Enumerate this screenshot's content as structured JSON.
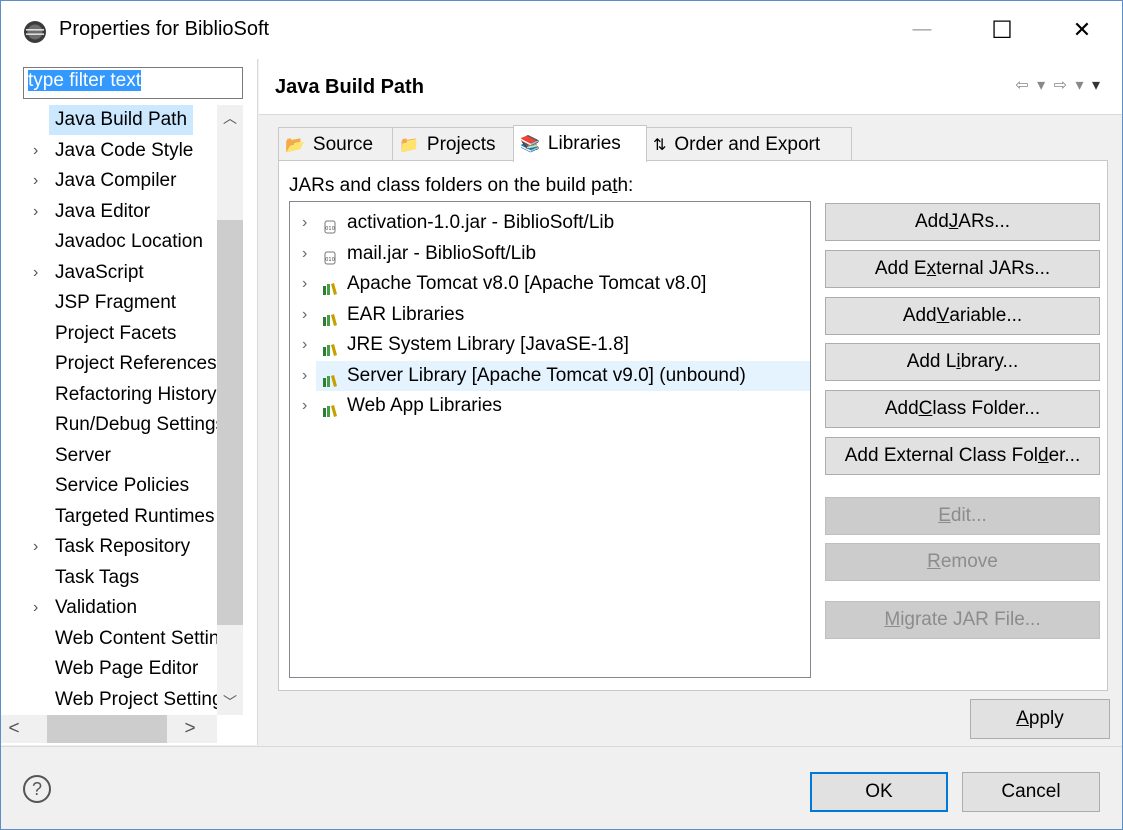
{
  "window": {
    "title": "Properties for BiblioSoft",
    "minimize_glyph": "—",
    "maximize_glyph": "☐",
    "close_glyph": "✕"
  },
  "filter": {
    "placeholder": "type filter text"
  },
  "tree": {
    "items": [
      {
        "label": "Java Build Path",
        "expandable": false,
        "selected": true
      },
      {
        "label": "Java Code Style",
        "expandable": true
      },
      {
        "label": "Java Compiler",
        "expandable": true
      },
      {
        "label": "Java Editor",
        "expandable": true
      },
      {
        "label": "Javadoc Location",
        "expandable": false
      },
      {
        "label": "JavaScript",
        "expandable": true
      },
      {
        "label": "JSP Fragment",
        "expandable": false
      },
      {
        "label": "Project Facets",
        "expandable": false
      },
      {
        "label": "Project References",
        "expandable": false
      },
      {
        "label": "Refactoring History",
        "expandable": false
      },
      {
        "label": "Run/Debug Settings",
        "expandable": false
      },
      {
        "label": "Server",
        "expandable": false
      },
      {
        "label": "Service Policies",
        "expandable": false
      },
      {
        "label": "Targeted Runtimes",
        "expandable": false
      },
      {
        "label": "Task Repository",
        "expandable": true
      },
      {
        "label": "Task Tags",
        "expandable": false
      },
      {
        "label": "Validation",
        "expandable": true
      },
      {
        "label": "Web Content Settings",
        "expandable": false
      },
      {
        "label": "Web Page Editor",
        "expandable": false
      },
      {
        "label": "Web Project Settings",
        "expandable": false
      }
    ]
  },
  "page": {
    "title": "Java Build Path",
    "nav": {
      "back": "⇦",
      "down": "▾",
      "forward": "⇨",
      "menu": "▾"
    }
  },
  "tabs": [
    {
      "label": "Source",
      "icon": "source-icon",
      "glyph": "📂"
    },
    {
      "label": "Projects",
      "icon": "projects-icon",
      "glyph": "📁"
    },
    {
      "label": "Libraries",
      "icon": "libraries-icon",
      "glyph": "📚",
      "active": true
    },
    {
      "label": "Order and Export",
      "icon": "order-export-icon",
      "glyph": "⇅"
    }
  ],
  "libraries": {
    "label_pre": "JARs and class folders on the build pa",
    "label_key": "t",
    "label_post": "h:",
    "entries": [
      {
        "text": "activation-1.0.jar - BiblioSoft/Lib",
        "icon": "jar-icon"
      },
      {
        "text": "mail.jar - BiblioSoft/Lib",
        "icon": "jar-icon"
      },
      {
        "text": "Apache Tomcat v8.0 [Apache Tomcat v8.0]",
        "icon": "library-icon"
      },
      {
        "text": "EAR Libraries",
        "icon": "library-icon"
      },
      {
        "text": "JRE System Library [JavaSE-1.8]",
        "icon": "library-icon"
      },
      {
        "text": "Server Library [Apache Tomcat v9.0] (unbound)",
        "icon": "library-icon",
        "hover": true
      },
      {
        "text": "Web App Libraries",
        "icon": "library-icon"
      }
    ],
    "buttons": [
      {
        "pre": "Add ",
        "key": "J",
        "post": "ARs...",
        "enabled": true
      },
      {
        "pre": "Add E",
        "key": "x",
        "post": "ternal JARs...",
        "enabled": true
      },
      {
        "pre": "Add ",
        "key": "V",
        "post": "ariable...",
        "enabled": true
      },
      {
        "pre": "Add L",
        "key": "i",
        "post": "brary...",
        "enabled": true
      },
      {
        "pre": "Add ",
        "key": "C",
        "post": "lass Folder...",
        "enabled": true
      },
      {
        "pre": "Add External Class Fol",
        "key": "d",
        "post": "er...",
        "enabled": true
      },
      {
        "pre": "",
        "key": "E",
        "post": "dit...",
        "enabled": false
      },
      {
        "pre": "",
        "key": "R",
        "post": "emove",
        "enabled": false
      },
      {
        "pre": "",
        "key": "M",
        "post": "igrate JAR File...",
        "enabled": false
      }
    ]
  },
  "apply": {
    "pre": "",
    "key": "A",
    "post": "pply"
  },
  "dialog": {
    "ok": "OK",
    "cancel": "Cancel",
    "help": "?"
  },
  "colors": {
    "selection": "#cce8ff",
    "hover": "#e5f3ff",
    "filter_highlight": "#3399ff",
    "default_border": "#0078d7"
  }
}
